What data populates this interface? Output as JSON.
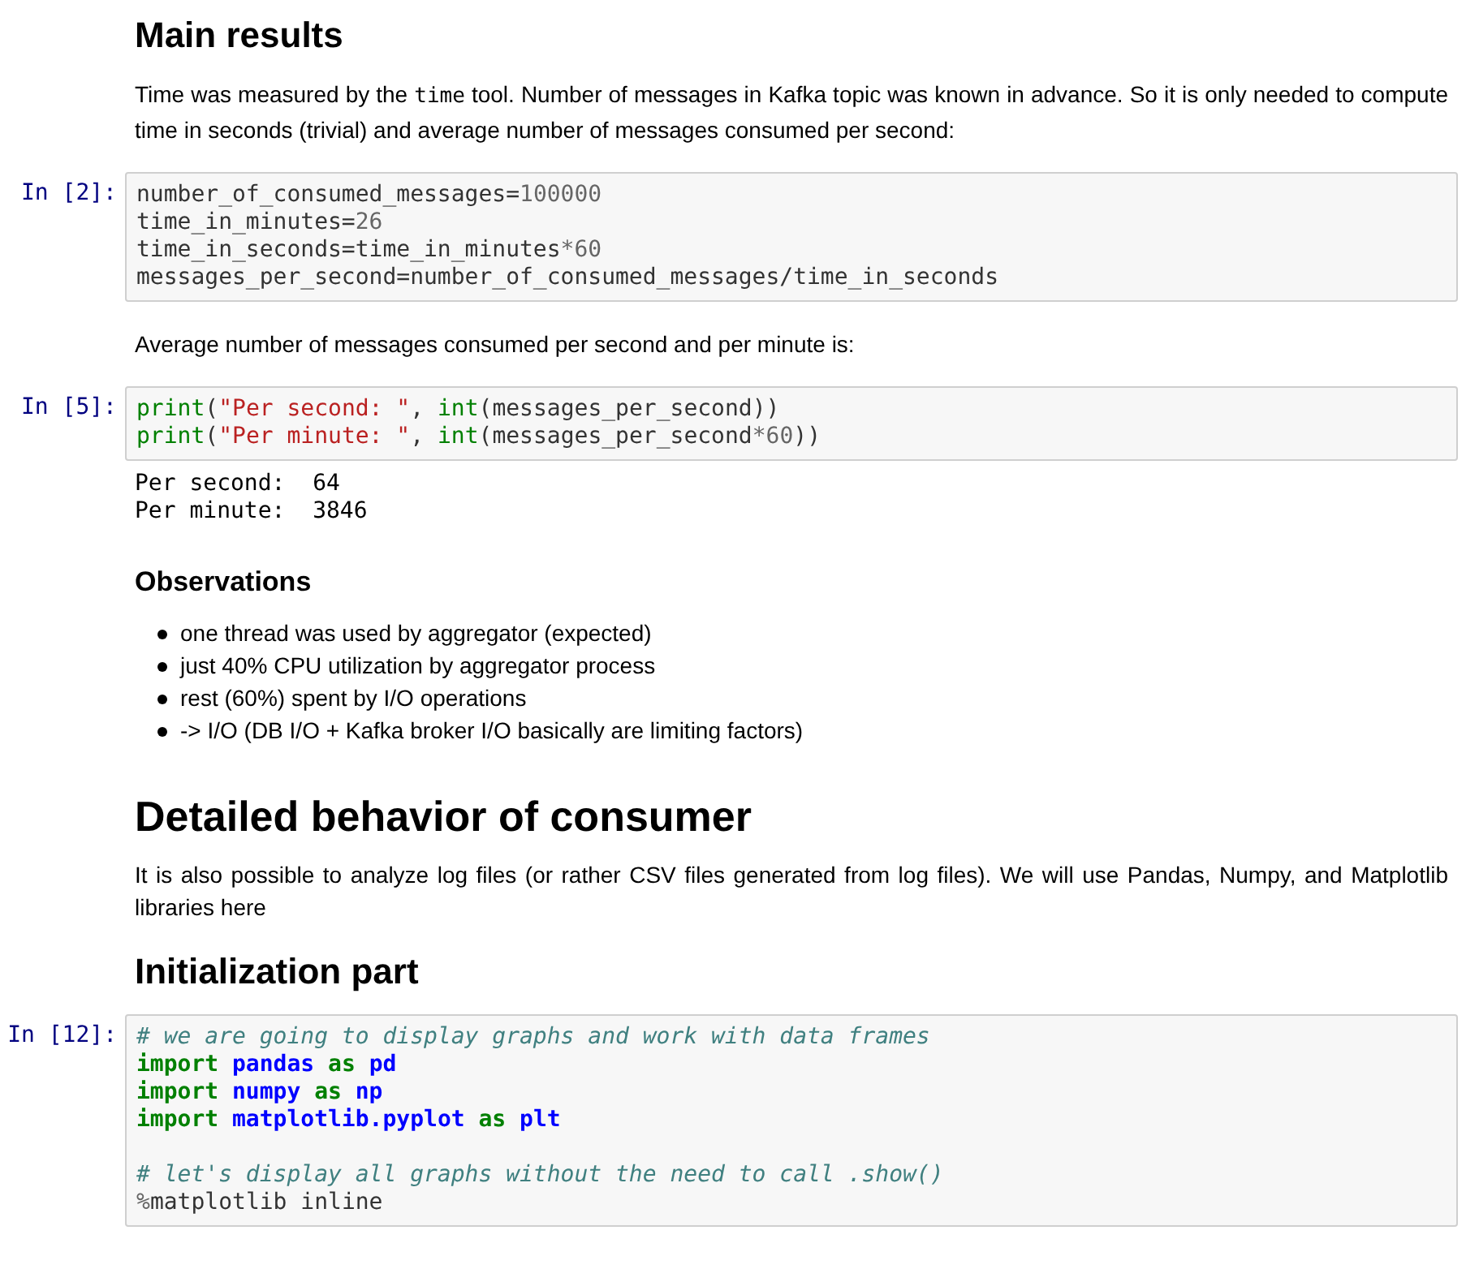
{
  "cells": [
    {
      "kind": "markdown",
      "blocks": [
        {
          "kind": "h2",
          "text": "Main results"
        },
        {
          "kind": "p",
          "parts": [
            {
              "kind": "text",
              "text": "Time was measured by the "
            },
            {
              "kind": "code",
              "text": "time"
            },
            {
              "kind": "text",
              "text": " tool. Number of messages in Kafka topic was known in advance. So it is only needed to compute time in seconds (trivial) and average number of messages consumed per second:"
            }
          ]
        }
      ]
    },
    {
      "kind": "code",
      "prompt": "In [2]:",
      "lines": [
        {
          "kind": "code",
          "tokens": [
            {
              "kind": "plain",
              "text": "number_of_consumed_messages="
            },
            {
              "kind": "number",
              "text": "100000"
            }
          ]
        },
        {
          "kind": "code",
          "tokens": [
            {
              "kind": "plain",
              "text": "time_in_minutes="
            },
            {
              "kind": "number",
              "text": "26"
            }
          ]
        },
        {
          "kind": "code",
          "tokens": [
            {
              "kind": "plain",
              "text": "time_in_seconds=time_in_minutes"
            },
            {
              "kind": "operator",
              "text": "*"
            },
            {
              "kind": "number",
              "text": "60"
            }
          ]
        },
        {
          "kind": "code",
          "tokens": [
            {
              "kind": "plain",
              "text": "messages_per_second=number_of_consumed_messages/time_in_seconds"
            }
          ]
        }
      ]
    },
    {
      "kind": "markdown",
      "blocks": [
        {
          "kind": "p",
          "parts": [
            {
              "kind": "text",
              "text": "Average number of messages consumed per second and per minute is:"
            }
          ]
        }
      ]
    },
    {
      "kind": "code",
      "prompt": "In [5]:",
      "lines": [
        {
          "kind": "code",
          "tokens": [
            {
              "kind": "builtin",
              "text": "print"
            },
            {
              "kind": "plain",
              "text": "("
            },
            {
              "kind": "string",
              "text": "\"Per second: \""
            },
            {
              "kind": "plain",
              "text": ", "
            },
            {
              "kind": "builtin",
              "text": "int"
            },
            {
              "kind": "plain",
              "text": "(messages_per_second))"
            }
          ]
        },
        {
          "kind": "code",
          "tokens": [
            {
              "kind": "builtin",
              "text": "print"
            },
            {
              "kind": "plain",
              "text": "("
            },
            {
              "kind": "string",
              "text": "\"Per minute: \""
            },
            {
              "kind": "plain",
              "text": ", "
            },
            {
              "kind": "builtin",
              "text": "int"
            },
            {
              "kind": "plain",
              "text": "(messages_per_second"
            },
            {
              "kind": "operator",
              "text": "*"
            },
            {
              "kind": "number",
              "text": "60"
            },
            {
              "kind": "plain",
              "text": "))"
            }
          ]
        }
      ],
      "output": [
        "Per second:  64",
        "Per minute:  3846"
      ]
    },
    {
      "kind": "markdown",
      "blocks": [
        {
          "kind": "h3",
          "text": "Observations"
        },
        {
          "kind": "ul",
          "items": [
            "one thread was used by aggregator (expected)",
            "just 40% CPU utilization by aggregator process",
            "rest (60%) spent by I/O operations",
            "-> I/O (DB I/O + Kafka broker I/O basically are limiting factors)"
          ]
        },
        {
          "kind": "h1",
          "text": "Detailed behavior of consumer"
        },
        {
          "kind": "p",
          "parts": [
            {
              "kind": "text",
              "text": "It is also possible to analyze log files (or rather CSV files generated from log files). We will use Pandas, Numpy, and Matplotlib libraries here"
            }
          ]
        },
        {
          "kind": "h2",
          "text": "Initialization part"
        }
      ]
    },
    {
      "kind": "code",
      "prompt": "In [12]:",
      "lines": [
        {
          "kind": "code",
          "tokens": [
            {
              "kind": "comment",
              "text": "# we are going to display graphs and work with data frames"
            }
          ]
        },
        {
          "kind": "code",
          "tokens": [
            {
              "kind": "keyword",
              "text": "import"
            },
            {
              "kind": "module",
              "text": " pandas"
            },
            {
              "kind": "keyword",
              "text": " as"
            },
            {
              "kind": "module",
              "text": " pd"
            }
          ]
        },
        {
          "kind": "code",
          "tokens": [
            {
              "kind": "keyword",
              "text": "import"
            },
            {
              "kind": "module",
              "text": " numpy"
            },
            {
              "kind": "keyword",
              "text": " as"
            },
            {
              "kind": "module",
              "text": " np"
            }
          ]
        },
        {
          "kind": "code",
          "tokens": [
            {
              "kind": "keyword",
              "text": "import"
            },
            {
              "kind": "module",
              "text": " matplotlib.pyplot"
            },
            {
              "kind": "keyword",
              "text": " as"
            },
            {
              "kind": "module",
              "text": " plt"
            }
          ]
        },
        {
          "kind": "blank"
        },
        {
          "kind": "code",
          "tokens": [
            {
              "kind": "comment",
              "text": "# let's display all graphs without the need to call .show()"
            }
          ]
        },
        {
          "kind": "code",
          "tokens": [
            {
              "kind": "operator",
              "text": "%"
            },
            {
              "kind": "plain",
              "text": "matplotlib inline"
            }
          ]
        }
      ]
    }
  ]
}
